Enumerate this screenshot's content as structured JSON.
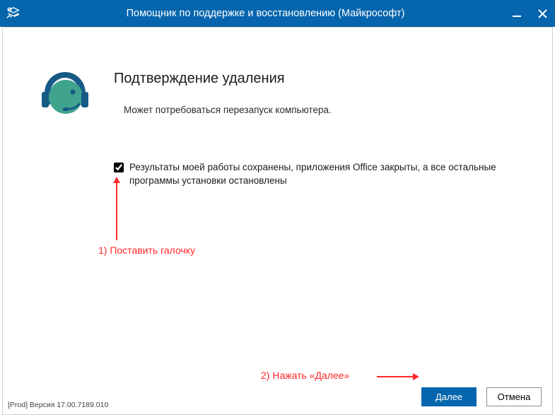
{
  "titlebar": {
    "title": "Помощник по поддержке и восстановлению (Майкрософт)"
  },
  "main": {
    "heading": "Подтверждение удаления",
    "subtext": "Может потребоваться перезапуск компьютера.",
    "checkbox": {
      "checked": true,
      "label": "Результаты моей работы сохранены, приложения Office закрыты, а все остальные программы установки остановлены"
    }
  },
  "annotations": {
    "step1": "1) Поставить галочку",
    "step2": "2) Нажать «Далее»"
  },
  "footer": {
    "version": "[Prod] Версия 17.00.7189.010",
    "buttons": {
      "next": "Далее",
      "cancel": "Отмена"
    }
  }
}
